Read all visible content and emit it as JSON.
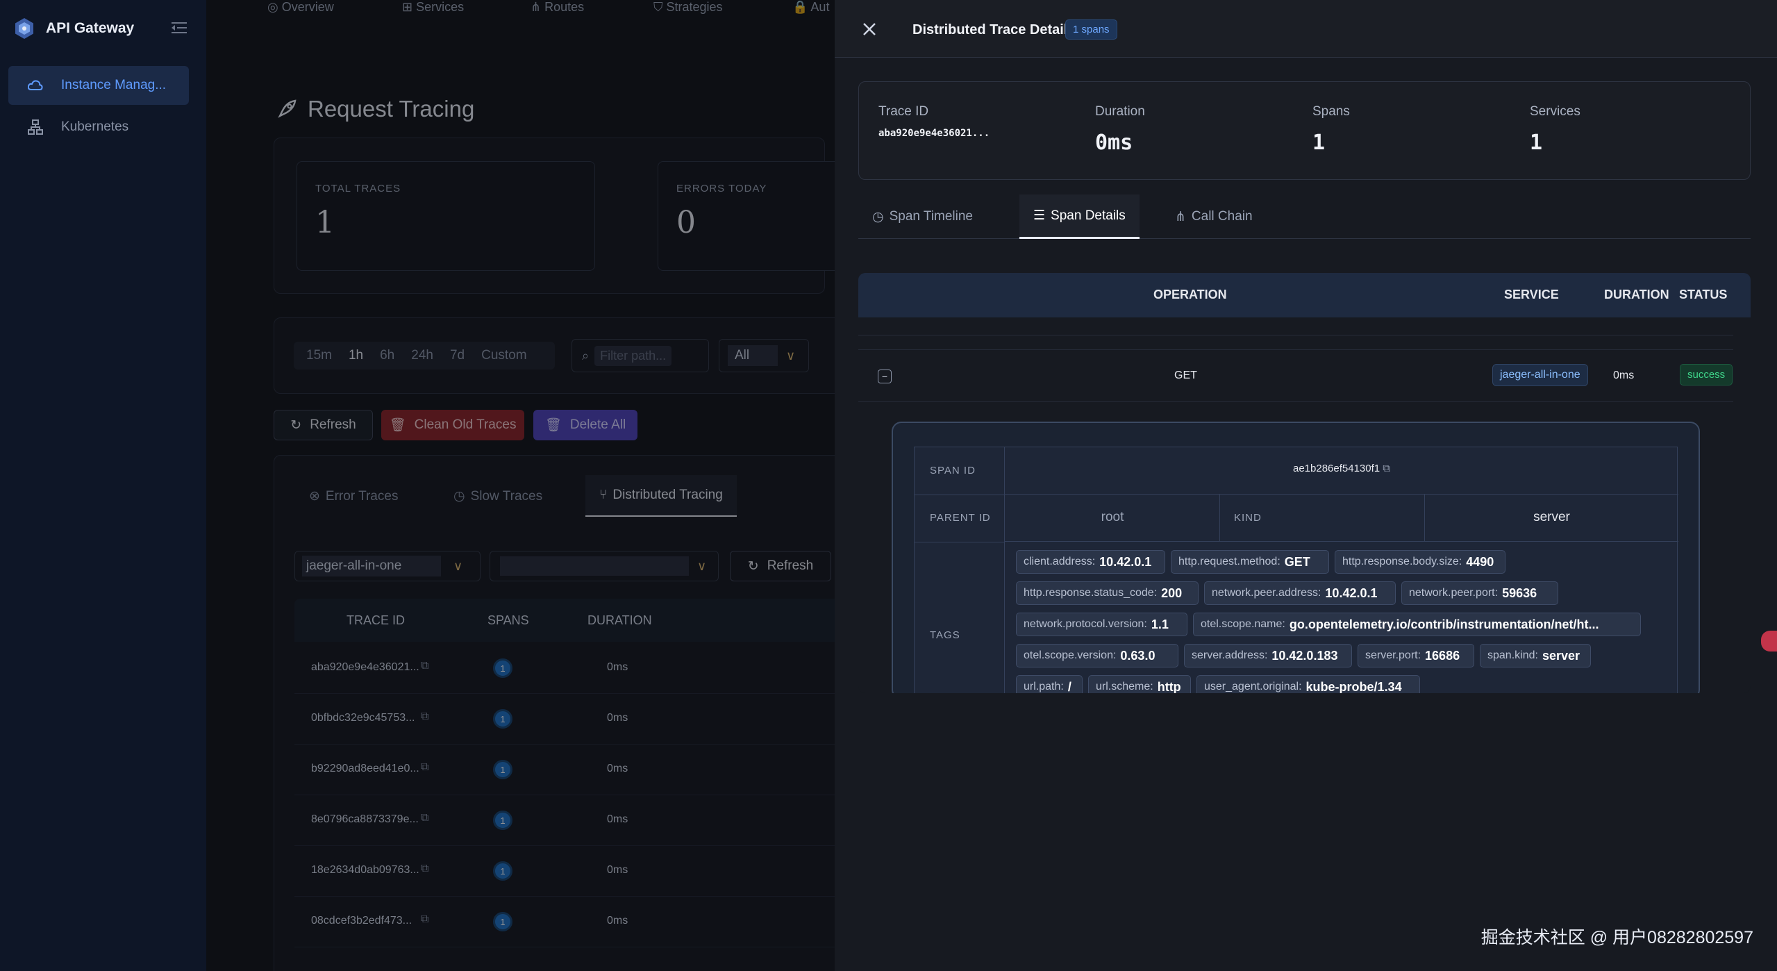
{
  "app": {
    "title": "API Gateway"
  },
  "sidebar": {
    "items": [
      {
        "label": "Instance Manag...",
        "active": true
      },
      {
        "label": "Kubernetes",
        "active": false
      }
    ]
  },
  "topnav": [
    "Overview",
    "Services",
    "Routes",
    "Strategies",
    "Aut"
  ],
  "page": {
    "title": "Request Tracing",
    "stats": [
      {
        "label": "TOTAL TRACES",
        "value": "1"
      },
      {
        "label": "ERRORS TODAY",
        "value": "0"
      }
    ],
    "time_ranges": [
      "15m",
      "1h",
      "6h",
      "24h",
      "7d",
      "Custom"
    ],
    "selected_range": "1h",
    "filter_placeholder": "Filter path...",
    "status_select": "All",
    "actions": {
      "refresh": "Refresh",
      "clean": "Clean Old Traces",
      "delete_all": "Delete All"
    },
    "tabs": [
      "Error Traces",
      "Slow Traces",
      "Distributed Tracing"
    ],
    "service_select": "jaeger-all-in-one",
    "refresh2": "Refresh",
    "table": {
      "headers": [
        "TRACE ID",
        "SPANS",
        "DURATION"
      ],
      "rows": [
        {
          "id": "aba920e9e4e36021...",
          "spans": "1",
          "duration": "0ms"
        },
        {
          "id": "0bfbdc32e9c45753...",
          "spans": "1",
          "duration": "0ms"
        },
        {
          "id": "b92290ad8eed41e0...",
          "spans": "1",
          "duration": "0ms"
        },
        {
          "id": "8e0796ca8873379e...",
          "spans": "1",
          "duration": "0ms"
        },
        {
          "id": "18e2634d0ab09763...",
          "spans": "1",
          "duration": "0ms"
        },
        {
          "id": "08cdcef3b2edf473...",
          "spans": "1",
          "duration": "0ms"
        }
      ]
    }
  },
  "drawer": {
    "title": "Distributed Trace Details",
    "spans_badge": "1 spans",
    "summary": {
      "trace_id_label": "Trace ID",
      "trace_id": "aba920e9e4e36021...",
      "duration_label": "Duration",
      "duration": "0ms",
      "spans_label": "Spans",
      "spans": "1",
      "services_label": "Services",
      "services": "1"
    },
    "tabs": [
      "Span Timeline",
      "Span Details",
      "Call Chain"
    ],
    "selected_tab": "Span Details",
    "table": {
      "headers": {
        "operation": "OPERATION",
        "service": "SERVICE",
        "duration": "DURATION",
        "status": "STATUS"
      },
      "row": {
        "operation": "GET",
        "service": "jaeger-all-in-one",
        "duration": "0ms",
        "status": "success"
      }
    },
    "detail": {
      "span_id_label": "SPAN ID",
      "span_id": "ae1b286ef54130f1",
      "parent_id_label": "PARENT ID",
      "parent_id": "root",
      "kind_label": "KIND",
      "kind": "server",
      "tags_label": "TAGS",
      "tags": [
        {
          "k": "client.address:",
          "v": "10.42.0.1"
        },
        {
          "k": "http.request.method:",
          "v": "GET"
        },
        {
          "k": "http.response.body.size:",
          "v": "4490"
        },
        {
          "k": "http.response.status_code:",
          "v": "200"
        },
        {
          "k": "network.peer.address:",
          "v": "10.42.0.1"
        },
        {
          "k": "network.peer.port:",
          "v": "59636"
        },
        {
          "k": "network.protocol.version:",
          "v": "1.1"
        },
        {
          "k": "otel.scope.name:",
          "v": "go.opentelemetry.io/contrib/instrumentation/net/ht..."
        },
        {
          "k": "otel.scope.version:",
          "v": "0.63.0"
        },
        {
          "k": "server.address:",
          "v": "10.42.0.183"
        },
        {
          "k": "server.port:",
          "v": "16686"
        },
        {
          "k": "span.kind:",
          "v": "server"
        },
        {
          "k": "url.path:",
          "v": "/"
        },
        {
          "k": "url.scheme:",
          "v": "http"
        },
        {
          "k": "user_agent.original:",
          "v": "kube-probe/1.34"
        }
      ]
    }
  },
  "watermark": "掘金技术社区 @ 用户08282802597",
  "colors": {
    "accent": "#5f9bff",
    "success": "#3fd58a",
    "danger": "#8a1f24",
    "purple": "#4b3fb8"
  }
}
